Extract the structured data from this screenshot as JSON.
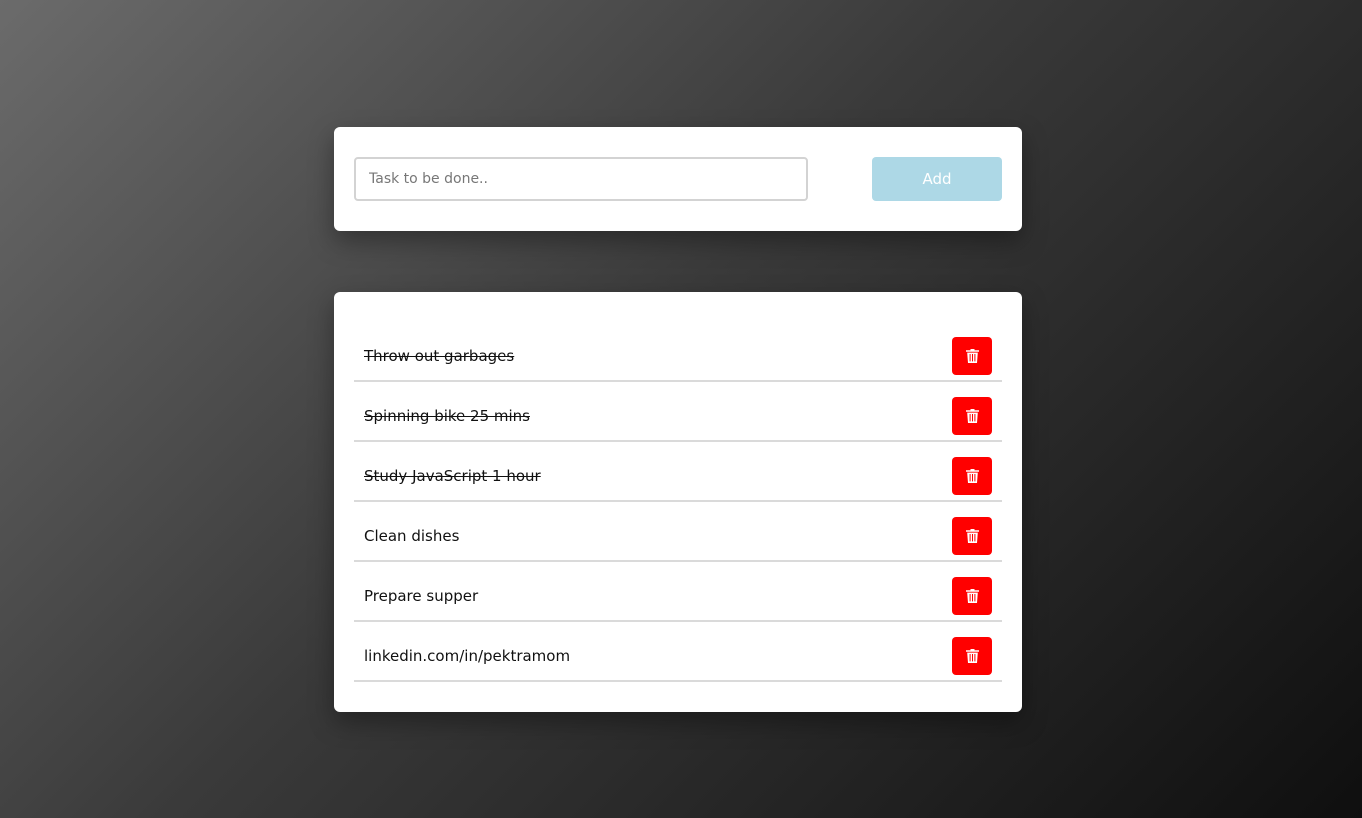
{
  "input_card": {
    "placeholder": "Task to be done..",
    "value": "",
    "add_label": "Add",
    "add_button_color": "#add8e6"
  },
  "tasks": [
    {
      "text": "Throw out garbages",
      "done": true
    },
    {
      "text": "Spinning bike 25 mins",
      "done": true
    },
    {
      "text": "Study JavaScript 1 hour",
      "done": true
    },
    {
      "text": "Clean dishes",
      "done": false
    },
    {
      "text": "Prepare supper",
      "done": false
    },
    {
      "text": "linkedin.com/in/pektramom",
      "done": false
    }
  ],
  "delete_icon": "trash-icon",
  "delete_button_color": "#ff0000"
}
